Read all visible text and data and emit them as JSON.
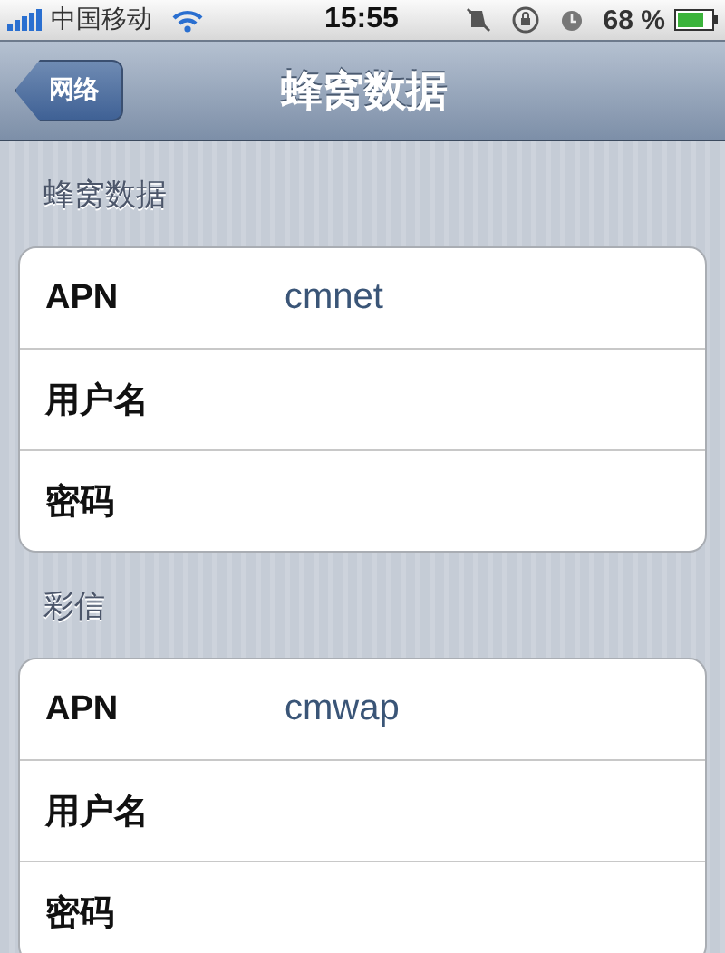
{
  "status_bar": {
    "carrier": "中国移动",
    "time": "15:55",
    "battery": "68 %"
  },
  "nav_bar": {
    "back": "网络",
    "title": "蜂窝数据"
  },
  "sections": [
    {
      "header": "蜂窝数据",
      "rows": [
        {
          "label": "APN",
          "value": "cmnet"
        },
        {
          "label": "用户名"
        },
        {
          "label": "密码"
        }
      ]
    },
    {
      "header": "彩信",
      "rows": [
        {
          "label": "APN",
          "value": "cmwap"
        },
        {
          "label": "用户名"
        },
        {
          "label": "密码"
        }
      ]
    }
  ]
}
